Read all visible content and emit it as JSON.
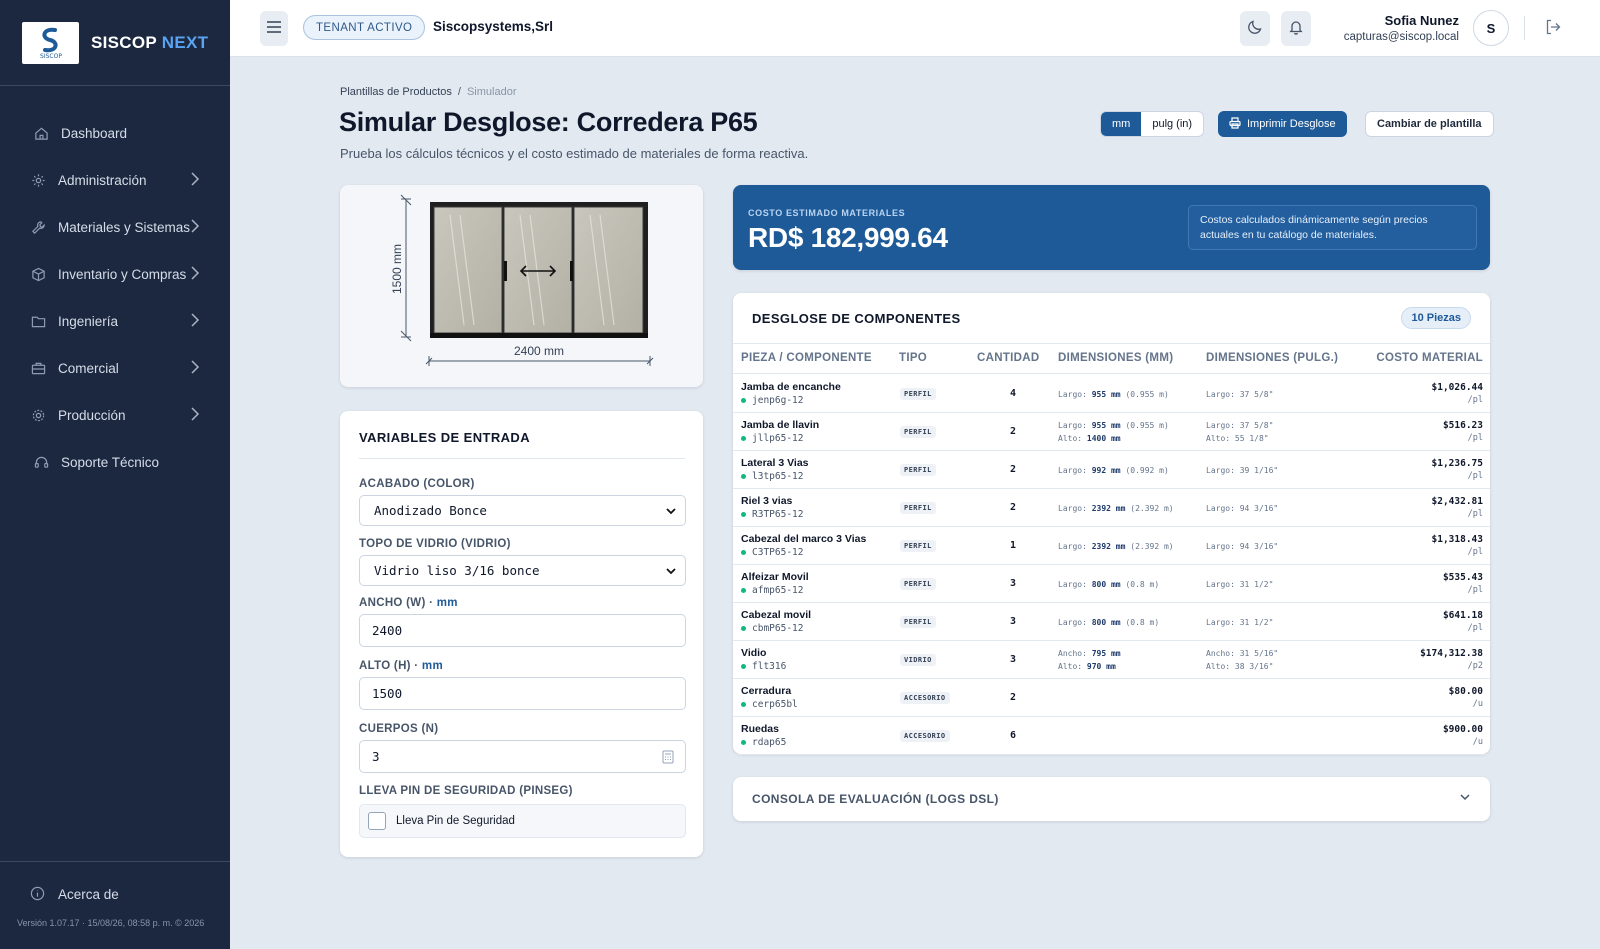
{
  "app": {
    "brand": "SISCOP",
    "brand_accent": "NEXT",
    "logo_text": "SISCOP"
  },
  "sidebar": {
    "items": [
      {
        "label": "Dashboard",
        "icon": "home-icon",
        "has_children": false
      },
      {
        "label": "Administración",
        "icon": "gear-icon",
        "has_children": true
      },
      {
        "label": "Materiales y Sistemas",
        "icon": "wrench-icon",
        "has_children": true
      },
      {
        "label": "Inventario y Compras",
        "icon": "box-icon",
        "has_children": true
      },
      {
        "label": "Ingeniería",
        "icon": "folder-icon",
        "has_children": true
      },
      {
        "label": "Comercial",
        "icon": "briefcase-icon",
        "has_children": true
      },
      {
        "label": "Producción",
        "icon": "cog-icon",
        "has_children": true
      },
      {
        "label": "Soporte Técnico",
        "icon": "headset-icon",
        "has_children": false
      }
    ],
    "about": "Acerca de",
    "version": "Versión 1.07.17 · 15/08/26, 08:58 p. m. © 2026"
  },
  "topbar": {
    "tenant_badge": "TENANT ACTIVO",
    "tenant_name": "Siscopsystems,Srl",
    "user_name": "Sofia Nunez",
    "user_email": "capturas@siscop.local",
    "avatar_letter": "S"
  },
  "header": {
    "breadcrumb": [
      "Plantillas de Productos",
      "Simulador"
    ],
    "title": "Simular Desglose: Corredera P65",
    "subtitle": "Prueba los cálculos técnicos y el costo estimado de materiales de forma reactiva.",
    "unit_mm": "mm",
    "unit_in": "pulg (in)",
    "active_unit": "mm",
    "print_label": "Imprimir Desglose",
    "change_label": "Cambiar de plantilla"
  },
  "preview": {
    "width_label": "2400 mm",
    "height_label": "1500 mm"
  },
  "vars": {
    "title": "VARIABLES DE ENTRADA",
    "acabado_label": "ACABADO (COLOR)",
    "acabado_value": "Anodizado Bonce",
    "vidrio_label": "TOPO DE VIDRIO (VIDRIO)",
    "vidrio_value": "Vidrio liso 3/16 bonce",
    "ancho_label": "ANCHO (W) · ",
    "ancho_unit": "mm",
    "ancho_value": "2400",
    "alto_label": "ALTO (H) · ",
    "alto_unit": "mm",
    "alto_value": "1500",
    "cuerpos_label": "CUERPOS (N)",
    "cuerpos_value": "3",
    "pin_label": "LLEVA PIN DE SEGURIDAD (PINSEG)",
    "pin_check_label": "Lleva Pin de Seguridad",
    "pin_checked": false
  },
  "cost": {
    "label": "COSTO ESTIMADO MATERIALES",
    "value": "RD$ 182,999.64",
    "note": "Costos calculados dinámicamente según precios actuales en tu catálogo de materiales."
  },
  "table": {
    "title": "DESGLOSE DE COMPONENTES",
    "count_badge": "10 Piezas",
    "headers": [
      "PIEZA / COMPONENTE",
      "TIPO",
      "CANTIDAD",
      "DIMENSIONES (MM)",
      "DIMENSIONES (PULG.)",
      "COSTO MATERIAL"
    ],
    "rows": [
      {
        "name": "Jamba de encanche",
        "code": "jenp6g-12",
        "tipo": "PERFIL",
        "qty": "4",
        "mm1_k": "Largo: ",
        "mm1_v": "955 mm",
        "mm1_x": " (0.955 m)",
        "mm2_k": "",
        "mm2_v": "",
        "in1": "Largo: 37 5/8\"",
        "in2": "",
        "cost": "$1,026.44",
        "per": "/pl"
      },
      {
        "name": "Jamba de llavin",
        "code": "jllp65-12",
        "tipo": "PERFIL",
        "qty": "2",
        "mm1_k": "Largo: ",
        "mm1_v": "955 mm",
        "mm1_x": " (0.955 m)",
        "mm2_k": "Alto: ",
        "mm2_v": "1400 mm",
        "in1": "Largo: 37 5/8\"",
        "in2": "Alto: 55 1/8\"",
        "cost": "$516.23",
        "per": "/pl"
      },
      {
        "name": "Lateral 3 Vias",
        "code": "l3tp65-12",
        "tipo": "PERFIL",
        "qty": "2",
        "mm1_k": "Largo: ",
        "mm1_v": "992 mm",
        "mm1_x": " (0.992 m)",
        "mm2_k": "",
        "mm2_v": "",
        "in1": "Largo: 39 1/16\"",
        "in2": "",
        "cost": "$1,236.75",
        "per": "/pl"
      },
      {
        "name": "Riel 3 vias",
        "code": "R3TP65-12",
        "tipo": "PERFIL",
        "qty": "2",
        "mm1_k": "Largo: ",
        "mm1_v": "2392 mm",
        "mm1_x": " (2.392 m)",
        "mm2_k": "",
        "mm2_v": "",
        "in1": "Largo: 94 3/16\"",
        "in2": "",
        "cost": "$2,432.81",
        "per": "/pl"
      },
      {
        "name": "Cabezal del marco 3 Vias",
        "code": "C3TP65-12",
        "tipo": "PERFIL",
        "qty": "1",
        "mm1_k": "Largo: ",
        "mm1_v": "2392 mm",
        "mm1_x": " (2.392 m)",
        "mm2_k": "",
        "mm2_v": "",
        "in1": "Largo: 94 3/16\"",
        "in2": "",
        "cost": "$1,318.43",
        "per": "/pl"
      },
      {
        "name": "Alfeizar Movil",
        "code": "afmp65-12",
        "tipo": "PERFIL",
        "qty": "3",
        "mm1_k": "Largo: ",
        "mm1_v": "800 mm",
        "mm1_x": " (0.8 m)",
        "mm2_k": "",
        "mm2_v": "",
        "in1": "Largo: 31 1/2\"",
        "in2": "",
        "cost": "$535.43",
        "per": "/pl"
      },
      {
        "name": "Cabezal movil",
        "code": "cbmP65-12",
        "tipo": "PERFIL",
        "qty": "3",
        "mm1_k": "Largo: ",
        "mm1_v": "800 mm",
        "mm1_x": " (0.8 m)",
        "mm2_k": "",
        "mm2_v": "",
        "in1": "Largo: 31 1/2\"",
        "in2": "",
        "cost": "$641.18",
        "per": "/pl"
      },
      {
        "name": "Vidio",
        "code": "flt316",
        "tipo": "VIDRIO",
        "qty": "3",
        "mm1_k": "Ancho: ",
        "mm1_v": "795 mm",
        "mm1_x": "",
        "mm2_k": "Alto: ",
        "mm2_v": "970 mm",
        "in1": "Ancho: 31 5/16\"",
        "in2": "Alto: 38 3/16\"",
        "cost": "$174,312.38",
        "per": "/p2"
      },
      {
        "name": "Cerradura",
        "code": "cerp65bl",
        "tipo": "ACCESORIO",
        "qty": "2",
        "mm1_k": "",
        "mm1_v": "",
        "mm1_x": "",
        "mm2_k": "",
        "mm2_v": "",
        "in1": "",
        "in2": "",
        "cost": "$80.00",
        "per": "/u"
      },
      {
        "name": "Ruedas",
        "code": "rdap65",
        "tipo": "ACCESORIO",
        "qty": "6",
        "mm1_k": "",
        "mm1_v": "",
        "mm1_x": "",
        "mm2_k": "",
        "mm2_v": "",
        "in1": "",
        "in2": "",
        "cost": "$900.00",
        "per": "/u"
      }
    ]
  },
  "console": {
    "title": "CONSOLA DE EVALUACIÓN (LOGS DSL)"
  },
  "colors": {
    "primary": "#1e5a98",
    "sidebar": "#1b2840",
    "status_dot": "#10b981"
  }
}
